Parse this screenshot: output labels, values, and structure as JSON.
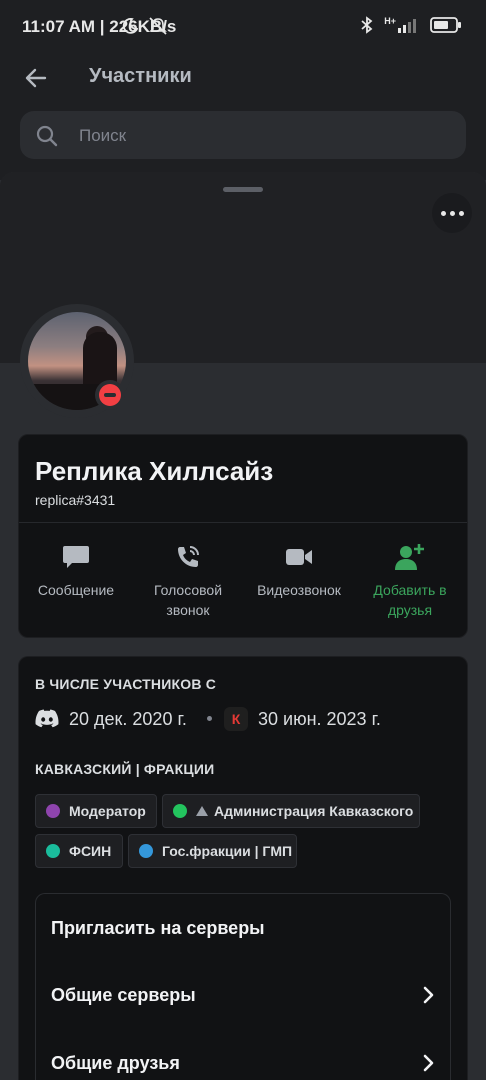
{
  "status_bar": {
    "time": "11:07 AM | 226KB/s",
    "network_label": "H+"
  },
  "header": {
    "title": "Участники"
  },
  "search": {
    "placeholder": "Поиск"
  },
  "profile": {
    "display_name": "Реплика Хиллсайз",
    "username": "replica#3431",
    "status": "dnd-icon"
  },
  "actions": [
    {
      "label": "Сообщение",
      "icon": "message-icon"
    },
    {
      "label": "Голосовой звонок",
      "icon": "voice-call-icon"
    },
    {
      "label": "Видеозвонок",
      "icon": "video-call-icon"
    },
    {
      "label": "Добавить в друзья",
      "icon": "add-friend-icon"
    }
  ],
  "member_since": {
    "title": "В ЧИСЛЕ УЧАСТНИКОВ С",
    "discord_date": "20 дек. 2020 г.",
    "server_date": "30 июн. 2023 г.",
    "server_icon_letter": "К"
  },
  "roles": {
    "title": "КАВКАЗСКИЙ | ФРАКЦИИ",
    "items": [
      {
        "name": "Модератор",
        "color": "#8e44ad"
      },
      {
        "name": "Администрация Кавказского",
        "color": "#23c45e"
      },
      {
        "name": "ФСИН",
        "color": "#1abc9c"
      },
      {
        "name": "Гос.фракции | ГМП",
        "color": "#3498db"
      }
    ]
  },
  "menu": [
    {
      "label": "Пригласить на серверы"
    },
    {
      "label": "Общие серверы"
    },
    {
      "label": "Общие друзья"
    }
  ],
  "colors": {
    "accent_green": "#3ba55d",
    "dnd_red": "#f23f43",
    "background": "#2b2d31"
  }
}
